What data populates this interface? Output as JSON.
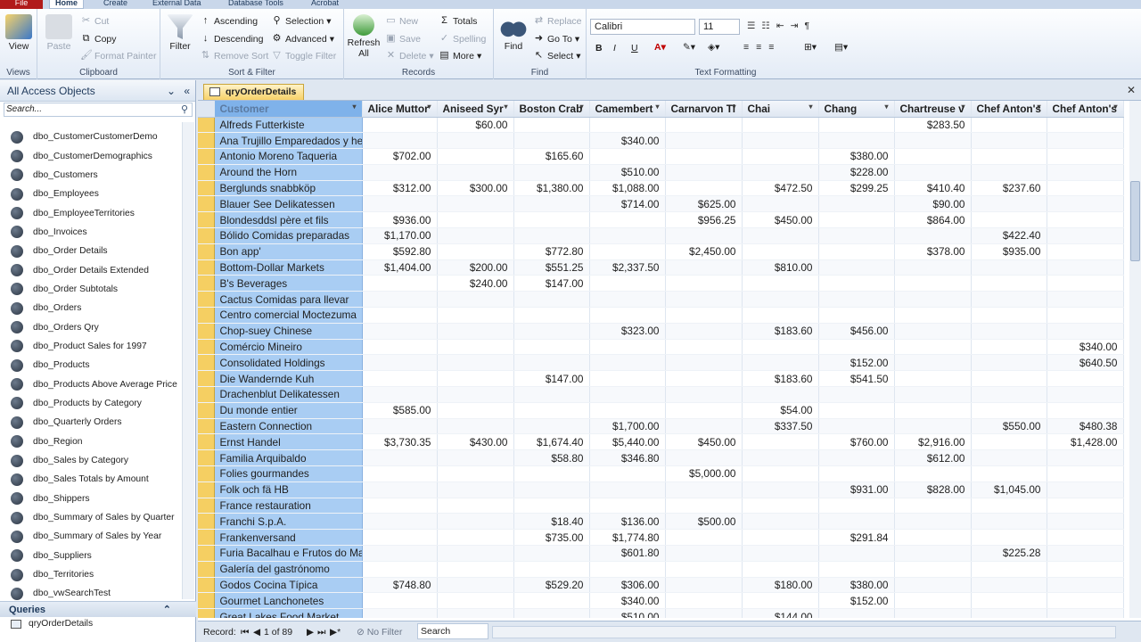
{
  "ribbon_tabs": [
    "File",
    "Home",
    "Create",
    "External Data",
    "Database Tools",
    "Acrobat"
  ],
  "views": {
    "view": "View",
    "label": "Views"
  },
  "clipboard": {
    "paste": "Paste",
    "cut": "Cut",
    "copy": "Copy",
    "format_painter": "Format Painter",
    "label": "Clipboard"
  },
  "sort_filter": {
    "filter": "Filter",
    "ascending": "Ascending",
    "descending": "Descending",
    "remove_sort": "Remove Sort",
    "selection": "Selection",
    "advanced": "Advanced",
    "toggle_filter": "Toggle Filter",
    "label": "Sort & Filter"
  },
  "records": {
    "refresh": "Refresh",
    "refresh_all": "All",
    "new": "New",
    "save": "Save",
    "delete": "Delete",
    "totals": "Totals",
    "spelling": "Spelling",
    "more": "More",
    "label": "Records"
  },
  "find": {
    "find": "Find",
    "replace": "Replace",
    "goto": "Go To",
    "select": "Select",
    "label": "Find"
  },
  "text_formatting": {
    "font": "Calibri",
    "size": "11",
    "label": "Text Formatting"
  },
  "nav": {
    "title": "All Access Objects",
    "search_placeholder": "Search...",
    "tables": [
      "dbo_CustomerCustomerDemo",
      "dbo_CustomerDemographics",
      "dbo_Customers",
      "dbo_Employees",
      "dbo_EmployeeTerritories",
      "dbo_Invoices",
      "dbo_Order Details",
      "dbo_Order Details Extended",
      "dbo_Order Subtotals",
      "dbo_Orders",
      "dbo_Orders Qry",
      "dbo_Product Sales for 1997",
      "dbo_Products",
      "dbo_Products Above Average Price",
      "dbo_Products by Category",
      "dbo_Quarterly Orders",
      "dbo_Region",
      "dbo_Sales by Category",
      "dbo_Sales Totals by Amount",
      "dbo_Shippers",
      "dbo_Summary of Sales by Quarter",
      "dbo_Summary of Sales by Year",
      "dbo_Suppliers",
      "dbo_Territories",
      "dbo_vwSearchTest"
    ],
    "queries_header": "Queries",
    "query_item": "qryOrderDetails"
  },
  "doc_tab": "qryOrderDetails",
  "grid": {
    "columns": [
      "Customer",
      "Alice Muttor",
      "Aniseed Syr",
      "Boston Crab",
      "Camembert",
      "Carnarvon Ti",
      "Chai",
      "Chang",
      "Chartreuse v",
      "Chef Anton's",
      "Chef Anton's"
    ],
    "rows": [
      [
        "Alfreds Futterkiste",
        "",
        "$60.00",
        "",
        "",
        "",
        "",
        "",
        "$283.50",
        "",
        ""
      ],
      [
        "Ana Trujillo Emparedados y he",
        "",
        "",
        "",
        "$340.00",
        "",
        "",
        "",
        "",
        "",
        ""
      ],
      [
        "Antonio Moreno Taqueria",
        "$702.00",
        "",
        "$165.60",
        "",
        "",
        "",
        "$380.00",
        "",
        "",
        ""
      ],
      [
        "Around the Horn",
        "",
        "",
        "",
        "$510.00",
        "",
        "",
        "$228.00",
        "",
        "",
        ""
      ],
      [
        "Berglunds snabbköp",
        "$312.00",
        "$300.00",
        "$1,380.00",
        "$1,088.00",
        "",
        "$472.50",
        "$299.25",
        "$410.40",
        "$237.60",
        ""
      ],
      [
        "Blauer See Delikatessen",
        "",
        "",
        "",
        "$714.00",
        "$625.00",
        "",
        "",
        "$90.00",
        "",
        ""
      ],
      [
        "Blondesddsl père et fils",
        "$936.00",
        "",
        "",
        "",
        "$956.25",
        "$450.00",
        "",
        "$864.00",
        "",
        ""
      ],
      [
        "Bólido Comidas preparadas",
        "$1,170.00",
        "",
        "",
        "",
        "",
        "",
        "",
        "",
        "$422.40",
        ""
      ],
      [
        "Bon app'",
        "$592.80",
        "",
        "$772.80",
        "",
        "$2,450.00",
        "",
        "",
        "$378.00",
        "$935.00",
        ""
      ],
      [
        "Bottom-Dollar Markets",
        "$1,404.00",
        "$200.00",
        "$551.25",
        "$2,337.50",
        "",
        "$810.00",
        "",
        "",
        "",
        ""
      ],
      [
        "B's Beverages",
        "",
        "$240.00",
        "$147.00",
        "",
        "",
        "",
        "",
        "",
        "",
        ""
      ],
      [
        "Cactus Comidas para llevar",
        "",
        "",
        "",
        "",
        "",
        "",
        "",
        "",
        "",
        ""
      ],
      [
        "Centro comercial Moctezuma",
        "",
        "",
        "",
        "",
        "",
        "",
        "",
        "",
        "",
        ""
      ],
      [
        "Chop-suey Chinese",
        "",
        "",
        "",
        "$323.00",
        "",
        "$183.60",
        "$456.00",
        "",
        "",
        ""
      ],
      [
        "Comércio Mineiro",
        "",
        "",
        "",
        "",
        "",
        "",
        "",
        "",
        "",
        "$340.00"
      ],
      [
        "Consolidated Holdings",
        "",
        "",
        "",
        "",
        "",
        "",
        "$152.00",
        "",
        "",
        "$640.50"
      ],
      [
        "Die Wandernde Kuh",
        "",
        "",
        "$147.00",
        "",
        "",
        "$183.60",
        "$541.50",
        "",
        "",
        ""
      ],
      [
        "Drachenblut Delikatessen",
        "",
        "",
        "",
        "",
        "",
        "",
        "",
        "",
        "",
        ""
      ],
      [
        "Du monde entier",
        "$585.00",
        "",
        "",
        "",
        "",
        "$54.00",
        "",
        "",
        "",
        ""
      ],
      [
        "Eastern Connection",
        "",
        "",
        "",
        "$1,700.00",
        "",
        "$337.50",
        "",
        "",
        "$550.00",
        "$480.38"
      ],
      [
        "Ernst Handel",
        "$3,730.35",
        "$430.00",
        "$1,674.40",
        "$5,440.00",
        "$450.00",
        "",
        "$760.00",
        "$2,916.00",
        "",
        "$1,428.00"
      ],
      [
        "Familia Arquibaldo",
        "",
        "",
        "$58.80",
        "$346.80",
        "",
        "",
        "",
        "$612.00",
        "",
        ""
      ],
      [
        "Folies gourmandes",
        "",
        "",
        "",
        "",
        "$5,000.00",
        "",
        "",
        "",
        "",
        ""
      ],
      [
        "Folk och fä HB",
        "",
        "",
        "",
        "",
        "",
        "",
        "$931.00",
        "$828.00",
        "$1,045.00",
        ""
      ],
      [
        "France restauration",
        "",
        "",
        "",
        "",
        "",
        "",
        "",
        "",
        "",
        ""
      ],
      [
        "Franchi S.p.A.",
        "",
        "",
        "$18.40",
        "$136.00",
        "$500.00",
        "",
        "",
        "",
        "",
        ""
      ],
      [
        "Frankenversand",
        "",
        "",
        "$735.00",
        "$1,774.80",
        "",
        "",
        "$291.84",
        "",
        "",
        ""
      ],
      [
        "Furia Bacalhau e Frutos do Ma",
        "",
        "",
        "",
        "$601.80",
        "",
        "",
        "",
        "",
        "$225.28",
        ""
      ],
      [
        "Galería del gastrónomo",
        "",
        "",
        "",
        "",
        "",
        "",
        "",
        "",
        "",
        ""
      ],
      [
        "Godos Cocina Típica",
        "$748.80",
        "",
        "$529.20",
        "$306.00",
        "",
        "$180.00",
        "$380.00",
        "",
        "",
        ""
      ],
      [
        "Gourmet Lanchonetes",
        "",
        "",
        "",
        "$340.00",
        "",
        "",
        "$152.00",
        "",
        "",
        ""
      ],
      [
        "Great Lakes Food Market",
        "",
        "",
        "",
        "$510.00",
        "",
        "$144.00",
        "",
        "",
        "",
        ""
      ]
    ]
  },
  "status": {
    "record_label": "Record:",
    "record_pos": "1 of 89",
    "no_filter": "No Filter",
    "search": "Search"
  }
}
